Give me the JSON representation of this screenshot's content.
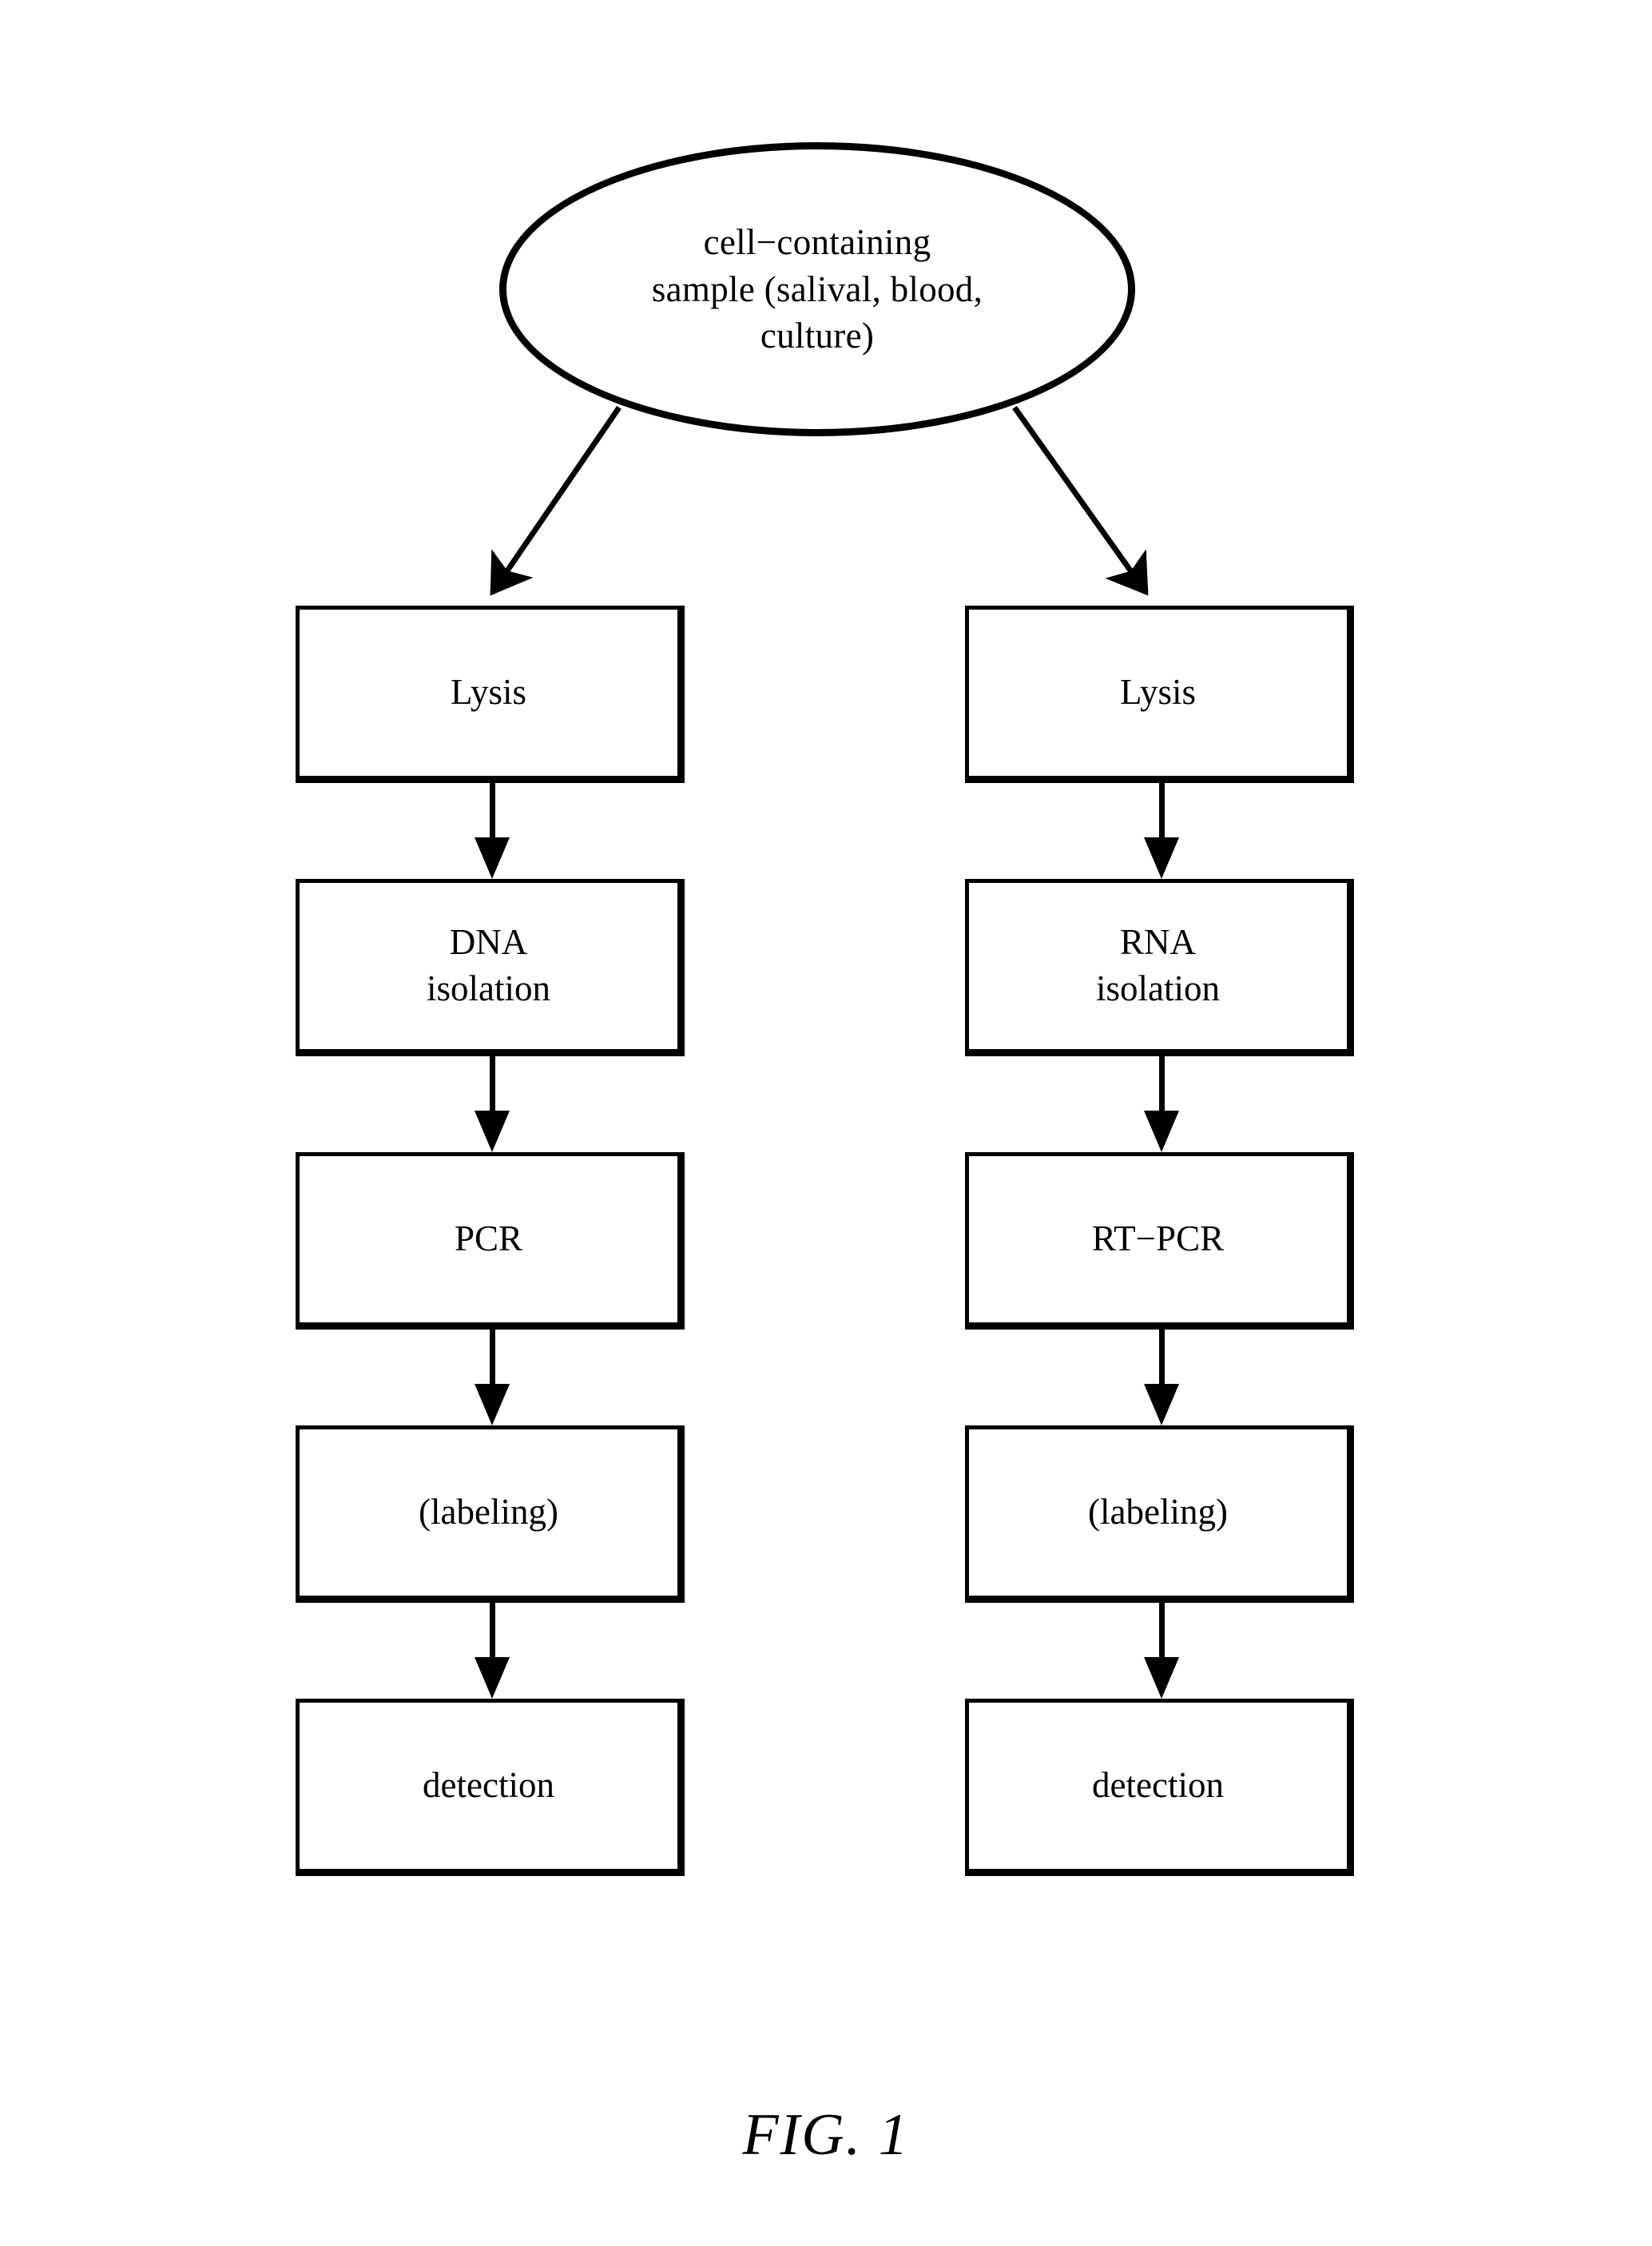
{
  "figure": {
    "caption": "FIG. 1",
    "source_node": {
      "shape": "ellipse",
      "text": "cell−containing\nsample  (salival,  blood,\nculture)"
    },
    "columns": [
      {
        "name": "dna-workflow",
        "steps": [
          {
            "id": "lysis",
            "label": "Lysis"
          },
          {
            "id": "dna-isolation",
            "label": "DNA\nisolation"
          },
          {
            "id": "pcr",
            "label": "PCR"
          },
          {
            "id": "labeling",
            "label": "(labeling)"
          },
          {
            "id": "detection",
            "label": "detection"
          }
        ]
      },
      {
        "name": "rna-workflow",
        "steps": [
          {
            "id": "lysis",
            "label": "Lysis"
          },
          {
            "id": "rna-isolation",
            "label": "RNA\nisolation"
          },
          {
            "id": "rt-pcr",
            "label": "RT−PCR"
          },
          {
            "id": "labeling",
            "label": "(labeling)"
          },
          {
            "id": "detection",
            "label": "detection"
          }
        ]
      }
    ],
    "colors": {
      "stroke": "#000000",
      "fill": "#ffffff",
      "text": "#000000"
    }
  }
}
